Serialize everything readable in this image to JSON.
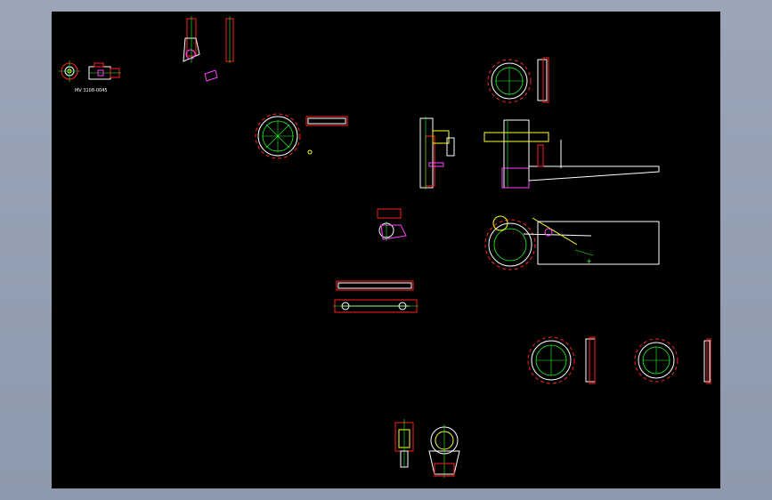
{
  "canvas": {
    "background": "#000000",
    "frame_color": "#9aa6b8"
  },
  "colors": {
    "red": "#ff2020",
    "white": "#ffffff",
    "green": "#20ff20",
    "yellow": "#ffff20",
    "magenta": "#ff40ff",
    "cyan": "#20e0ff"
  },
  "labels": {
    "part_number": "MV 3108-0045"
  }
}
